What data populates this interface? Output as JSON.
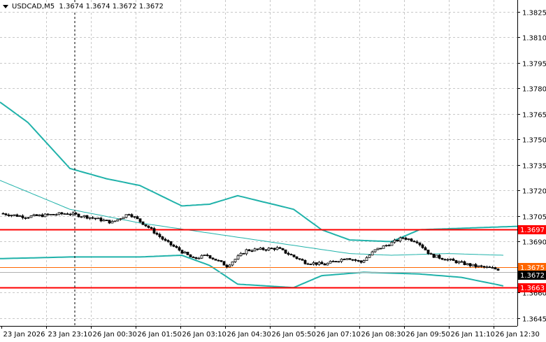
{
  "header": {
    "symbol": "USDCAD,M5",
    "ohlc": "1.3674 1.3674 1.3672 1.3672"
  },
  "colors": {
    "band": "#20b2aa",
    "resistance": "#ff0000",
    "current": "#ff6600",
    "price_tag_bg": "#000000"
  },
  "chart_data": {
    "type": "candlestick",
    "title": "USDCAD,M5",
    "ylim": [
      1.364,
      1.383
    ],
    "y_ticks": [
      "1.3825",
      "1.3810",
      "1.3795",
      "1.3780",
      "1.3765",
      "1.3750",
      "1.3735",
      "1.3720",
      "1.3705",
      "1.3690",
      "1.3660",
      "1.3645"
    ],
    "x_ticks": [
      "23 Jan 2026",
      "23 Jan 23:10",
      "26 Jan 00:30",
      "26 Jan 01:50",
      "26 Jan 03:10",
      "26 Jan 04:30",
      "26 Jan 05:50",
      "26 Jan 07:10",
      "26 Jan 08:30",
      "26 Jan 09:50",
      "26 Jan 11:10",
      "26 Jan 12:30"
    ],
    "bars_per_tick": 16,
    "bar_count": 178,
    "price_path": [
      [
        0,
        1.37066
      ],
      [
        9,
        1.37046
      ],
      [
        24,
        1.37066
      ],
      [
        31,
        1.37046
      ],
      [
        40,
        1.37013
      ],
      [
        46,
        1.37066
      ],
      [
        53,
        1.36984
      ],
      [
        59,
        1.36902
      ],
      [
        69,
        1.36799
      ],
      [
        74,
        1.3682
      ],
      [
        81,
        1.36758
      ],
      [
        88,
        1.36849
      ],
      [
        99,
        1.36861
      ],
      [
        104,
        1.3682
      ],
      [
        109,
        1.36779
      ],
      [
        116,
        1.36766
      ],
      [
        124,
        1.36807
      ],
      [
        129,
        1.36779
      ],
      [
        134,
        1.36849
      ],
      [
        144,
        1.36923
      ],
      [
        149,
        1.36902
      ],
      [
        154,
        1.3682
      ],
      [
        161,
        1.3679
      ],
      [
        169,
        1.36758
      ],
      [
        178,
        1.36738
      ]
    ],
    "upper_band": [
      [
        0,
        1.3772
      ],
      [
        10,
        1.376
      ],
      [
        25,
        1.3733
      ],
      [
        38,
        1.3727
      ],
      [
        50,
        1.3723
      ],
      [
        65,
        1.3711
      ],
      [
        75,
        1.3712
      ],
      [
        85,
        1.3717
      ],
      [
        95,
        1.3713
      ],
      [
        105,
        1.3709
      ],
      [
        115,
        1.3697
      ],
      [
        125,
        1.3691
      ],
      [
        140,
        1.369
      ],
      [
        150,
        1.3697
      ],
      [
        185,
        1.3699
      ]
    ],
    "middle_band": [
      [
        0,
        1.3726
      ],
      [
        25,
        1.3709
      ],
      [
        50,
        1.3701
      ],
      [
        75,
        1.3695
      ],
      [
        100,
        1.3689
      ],
      [
        125,
        1.3683
      ],
      [
        140,
        1.3682
      ],
      [
        160,
        1.3683
      ],
      [
        180,
        1.3682
      ]
    ],
    "lower_band": [
      [
        0,
        1.368
      ],
      [
        25,
        1.3681
      ],
      [
        50,
        1.3681
      ],
      [
        65,
        1.3682
      ],
      [
        75,
        1.3676
      ],
      [
        85,
        1.3665
      ],
      [
        95,
        1.3664
      ],
      [
        105,
        1.3663
      ],
      [
        115,
        1.367
      ],
      [
        130,
        1.3672
      ],
      [
        150,
        1.3671
      ],
      [
        165,
        1.3669
      ],
      [
        180,
        1.3664
      ]
    ],
    "levels": [
      {
        "label": "1.3697",
        "price": 1.3697,
        "kind": "resistance"
      },
      {
        "label": "1.3675",
        "price": 1.3675,
        "kind": "current"
      },
      {
        "label": "1.3663",
        "price": 1.3663,
        "kind": "resistance"
      }
    ],
    "last_price": {
      "label": "1.3672",
      "price": 1.3672
    }
  }
}
